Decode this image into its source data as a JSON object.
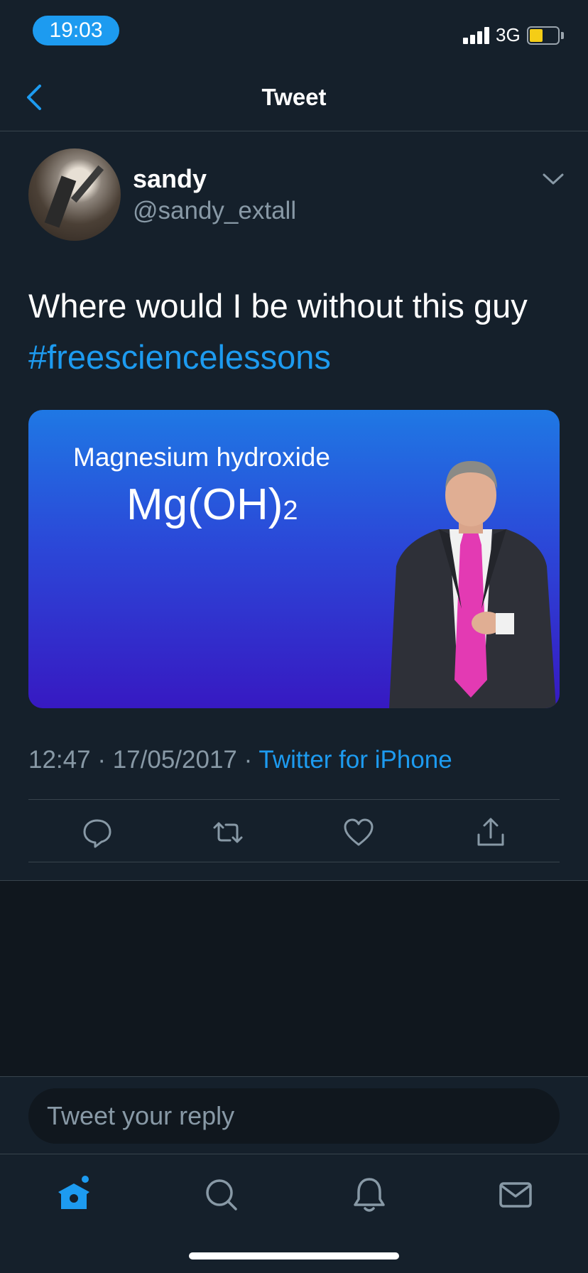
{
  "status_bar": {
    "time": "19:03",
    "network": "3G",
    "battery_level": 0.4,
    "accent_color": "#1d9bf0"
  },
  "header": {
    "title": "Tweet",
    "back_icon": "chevron-left-icon"
  },
  "tweet": {
    "author_name": "sandy",
    "author_handle": "@sandy_extall",
    "text": "Where would I be without this guy",
    "hashtag": "#freesciencelessons",
    "media": {
      "title": "Magnesium hydroxide",
      "formula_main": "Mg(OH)",
      "formula_subscript": "2"
    },
    "time": "12:47",
    "date": "17/05/2017",
    "separator": "·",
    "source": "Twitter for iPhone",
    "actions": [
      "reply-icon",
      "retweet-icon",
      "like-icon",
      "share-icon"
    ]
  },
  "reply": {
    "placeholder": "Tweet your reply"
  },
  "tab_bar": {
    "tabs": [
      "home-icon",
      "search-icon",
      "notifications-icon",
      "messages-icon"
    ],
    "active": "home-icon"
  }
}
